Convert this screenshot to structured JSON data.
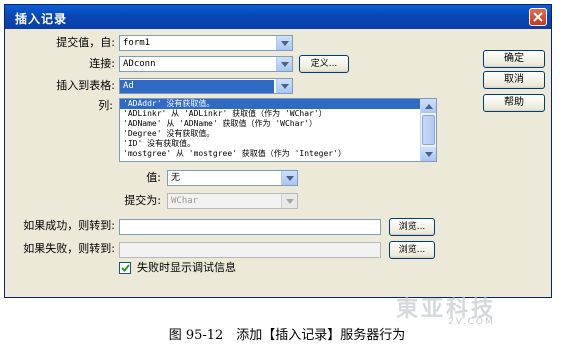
{
  "window": {
    "title": "插入记录"
  },
  "form": {
    "submit_values_label": "提交值，自:",
    "submit_values_value": "form1",
    "connection_label": "连接:",
    "connection_value": "ADconn",
    "define_button": "定义...",
    "insert_table_label": "插入到表格:",
    "insert_table_value": "Ad",
    "columns_label": "列:",
    "columns": [
      "'ADAddr' 没有获取值。",
      "'ADLinkr' 从 'ADLinkr' 获取值（作为 'WChar'）",
      "'ADName' 从 'ADName' 获取值（作为 'WChar'）",
      "'Degree' 没有获取值。",
      "'ID' 没有获取值。",
      "'mostgree' 从 'mostgree' 获取值（作为 'Integer'）"
    ],
    "value_label": "值:",
    "value_value": "无",
    "submit_as_label": "提交为:",
    "submit_as_value": "WChar",
    "on_success_label": "如果成功，则转到:",
    "on_success_value": "",
    "on_success_browse": "浏览...",
    "on_failure_label": "如果失败，则转到:",
    "on_failure_value": "",
    "on_failure_browse": "浏览...",
    "debug_checkbox_label": "失败时显示调试信息",
    "debug_checked": true
  },
  "buttons": {
    "ok": "确定",
    "cancel": "取消",
    "help": "帮助"
  },
  "caption": "图 95-12　添加【插入记录】服务器行为",
  "watermark": {
    "main": "東亚科技",
    "sub": "2V.COM"
  }
}
